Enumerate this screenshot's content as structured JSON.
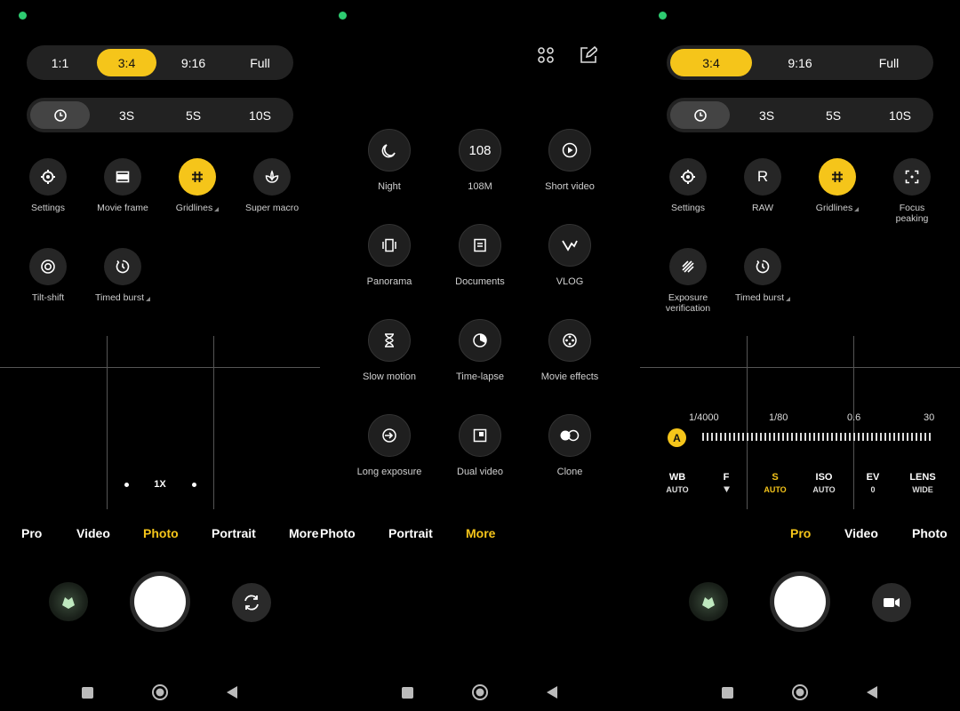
{
  "panel1": {
    "aspect_options": [
      "1:1",
      "3:4",
      "9:16",
      "Full"
    ],
    "timer_options": [
      "3S",
      "5S",
      "10S"
    ],
    "tiles": [
      {
        "label": "Settings",
        "icon": "gear-icon"
      },
      {
        "label": "Movie frame",
        "icon": "movie-frame-icon"
      },
      {
        "label": "Gridlines",
        "icon": "grid-icon"
      },
      {
        "label": "Super macro",
        "icon": "macro-flower-icon"
      },
      {
        "label": "Tilt-shift",
        "icon": "tilt-shift-icon"
      },
      {
        "label": "Timed burst",
        "icon": "timed-burst-icon"
      }
    ],
    "zoom_label": "1X",
    "modes": [
      "Pro",
      "Video",
      "Photo",
      "Portrait",
      "More"
    ]
  },
  "panel2": {
    "items": [
      {
        "label": "Night",
        "icon": "moon-icon"
      },
      {
        "label": "108M",
        "icon_text": "108"
      },
      {
        "label": "Short video",
        "icon": "play-icon"
      },
      {
        "label": "Panorama",
        "icon": "panorama-icon"
      },
      {
        "label": "Documents",
        "icon": "document-icon"
      },
      {
        "label": "VLOG",
        "icon": "vlog-icon"
      },
      {
        "label": "Slow motion",
        "icon": "hourglass-icon"
      },
      {
        "label": "Time-lapse",
        "icon": "timelapse-icon"
      },
      {
        "label": "Movie effects",
        "icon": "film-reel-icon"
      },
      {
        "label": "Long exposure",
        "icon": "long-exposure-icon"
      },
      {
        "label": "Dual video",
        "icon": "dual-video-icon"
      },
      {
        "label": "Clone",
        "icon": "clone-icon"
      }
    ],
    "modes": [
      "Photo",
      "Portrait",
      "More"
    ]
  },
  "panel3": {
    "aspect_options": [
      "3:4",
      "9:16",
      "Full"
    ],
    "timer_options": [
      "3S",
      "5S",
      "10S"
    ],
    "tiles": [
      {
        "label": "Settings",
        "icon": "gear-icon"
      },
      {
        "label": "RAW",
        "icon_text": "R"
      },
      {
        "label": "Gridlines",
        "icon": "grid-icon"
      },
      {
        "label": "Focus peaking",
        "icon": "focus-peaking-icon"
      },
      {
        "label": "Exposure verification",
        "icon": "exposure-stripes-icon"
      },
      {
        "label": "Timed burst",
        "icon": "timed-burst-icon"
      }
    ],
    "shutter_ticks": [
      "1/4000",
      "1/80",
      "0.6",
      "30"
    ],
    "auto_badge": "A",
    "params": [
      {
        "key": "WB",
        "value": "AUTO"
      },
      {
        "key": "F",
        "value": ""
      },
      {
        "key": "S",
        "value": "AUTO"
      },
      {
        "key": "ISO",
        "value": "AUTO"
      },
      {
        "key": "EV",
        "value": "0"
      },
      {
        "key": "LENS",
        "value": "WIDE"
      }
    ],
    "modes": [
      "Pro",
      "Video",
      "Photo"
    ]
  },
  "colors": {
    "accent": "#f5c51a",
    "status_dot": "#2ecc71",
    "background": "#000000"
  }
}
